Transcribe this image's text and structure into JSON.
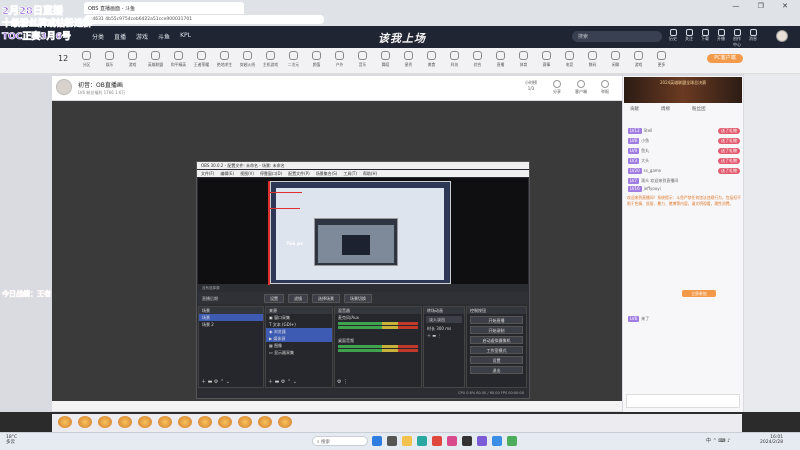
{
  "browser": {
    "tab_title": "OBS 直播画面 - 斗鱼",
    "url": "s4631 4b55c9754ceb6422a51cce900031701",
    "window_controls": "— ❐ ✕"
  },
  "site": {
    "nav": [
      "分类",
      "直播",
      "游戏",
      "斗鱼",
      "KPL"
    ],
    "logo": "该我上场",
    "search_placeholder": "搜索",
    "header_icons": [
      "历史",
      "关注",
      "下载",
      "开播",
      "创作中心",
      "消息"
    ]
  },
  "category_bar": {
    "count": "12",
    "items": [
      "分区",
      "娱乐",
      "游戏",
      "英雄联盟",
      "和平精英",
      "王者荣耀",
      "绝地求生",
      "穿越火线",
      "主机游戏",
      "二次元",
      "颜值",
      "户外",
      "音乐",
      "舞蹈",
      "星秀",
      "美食",
      "科技",
      "综合",
      "直播",
      "体育",
      "赛事",
      "电竞",
      "数码",
      "闲聊",
      "游戏",
      "更多"
    ],
    "pc_button": "PC客户端"
  },
  "room": {
    "title": "初音：OB直播画",
    "meta": "LV6  粉丝福利  1766  1.6万",
    "rank_label": "小时榜",
    "rank_value": "1/3",
    "buttons": [
      "分享",
      "客户端",
      "举报"
    ]
  },
  "obs": {
    "title": "OBS 30.0.2 - 配置文件: 未命名 - 场景: 未命名",
    "menu": [
      "文件(F)",
      "编辑(E)",
      "视图(V)",
      "停靠窗口(D)",
      "配置文件(P)",
      "场景集合(S)",
      "工具(T)",
      "帮助(H)"
    ],
    "px_label": "766 px",
    "status_line": "没有选择源",
    "scene_label": "直播后期",
    "scene_buttons": [
      "设置",
      "滤镜",
      "选择场景",
      "场景切换"
    ],
    "docks": {
      "scenes": {
        "title": "场景",
        "items": [
          "场景",
          "场景 2"
        ]
      },
      "sources": {
        "title": "来源",
        "items": [
          "窗口采集",
          "文本 (GDI+)",
          "浏览器",
          "媒体源",
          "图像",
          "显示器采集"
        ]
      },
      "mixer": {
        "title": "混音器",
        "tracks": [
          "桌面音频",
          "麦克风/Aux"
        ]
      },
      "transitions": {
        "title": "转场动画",
        "type": "淡入淡出",
        "duration_label": "时长",
        "duration": "300 ms"
      },
      "controls": {
        "title": "控制按钮",
        "buttons": [
          "开始直播",
          "开始录制",
          "启动虚拟摄像机",
          "工作室模式",
          "设置",
          "退出"
        ]
      }
    },
    "footer": "CPU 0.6%  60.00 / 60.00 FPS  00:00:00"
  },
  "sidebar": {
    "banner_text": "2024英雄联盟全球总决赛",
    "tabs": [
      "贡献",
      "周榜",
      "粉丝团"
    ],
    "chat_lines": [
      {
        "level": "LV12",
        "user": "Stell",
        "text": "",
        "pill": "送了礼物"
      },
      {
        "level": "LV8",
        "user": "小鱼",
        "text": "",
        "pill": "送了礼物"
      },
      {
        "level": "LV9",
        "user": "鱼丸",
        "text": "",
        "pill": "送了礼物"
      },
      {
        "level": "LV3",
        "user": "大头",
        "text": "",
        "pill": "送了礼物"
      },
      {
        "level": "LV20",
        "user": "ss_game",
        "text": "",
        "pill": "送了礼物"
      },
      {
        "level": "LV7",
        "user": "观众",
        "text": "欢迎来到直播间",
        "pill": ""
      },
      {
        "level": "LV16",
        "user": "jeffyouyi",
        "text": "",
        "pill": ""
      }
    ],
    "paragraph": "欢迎来到直播间！系统提示：斗鱼严禁任何违法违规行为，包括但不限于色情、低俗、暴力、赌博等内容，请文明观看，理性消费。",
    "action_button": "立即参加",
    "last_line_level": "LV8",
    "last_line_text": "来了"
  },
  "overlay": {
    "line1": "2月28日直播",
    "line2": "十级粉丝牌或钻粉进群",
    "line3": "TOC正赛3月6号",
    "line4": "今日战绩：王者"
  },
  "taskbar": {
    "weather": "18°C\n多云",
    "search": "搜索",
    "tray": "中 ⌃ ⌨ ♪",
    "time": "16:01",
    "date": "2024/2/28"
  },
  "colors": {
    "accent": "#f29a4a",
    "overlay_purple": "#7b3fd6",
    "overlay_red": "#ff2a2a",
    "obs_selected": "#3d5bb3"
  }
}
